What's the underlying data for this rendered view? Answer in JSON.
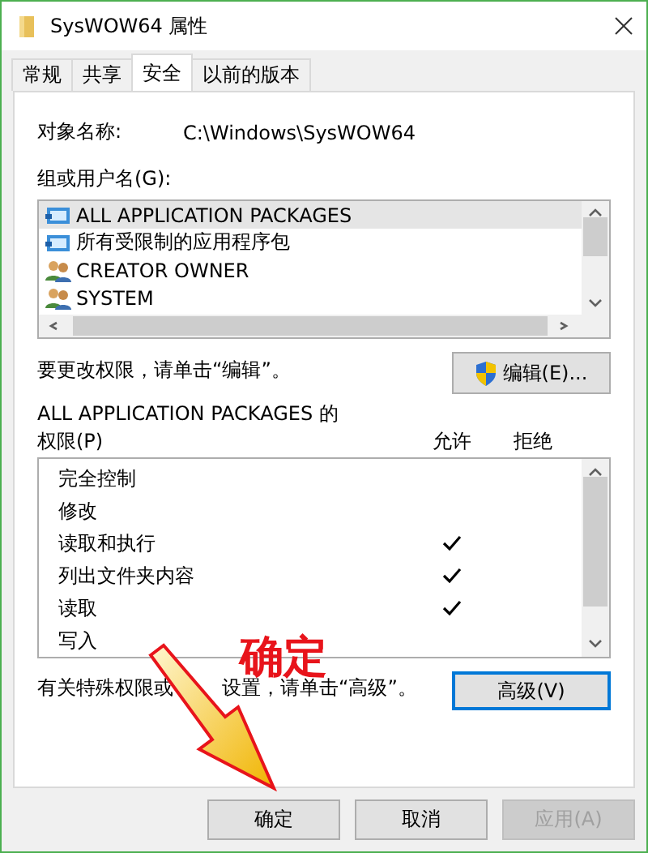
{
  "window": {
    "title": "SysWOW64 属性"
  },
  "tabs": [
    {
      "label": "常规",
      "selected": false
    },
    {
      "label": "共享",
      "selected": false
    },
    {
      "label": "安全",
      "selected": true
    },
    {
      "label": "以前的版本",
      "selected": false
    }
  ],
  "object_name": {
    "label": "对象名称:",
    "value": "C:\\Windows\\SysWOW64"
  },
  "groups": {
    "label": "组或用户名(G):",
    "items": [
      {
        "name": "ALL APPLICATION PACKAGES",
        "kind": "package",
        "selected": true
      },
      {
        "name": "所有受限制的应用程序包",
        "kind": "package",
        "selected": false
      },
      {
        "name": "CREATOR OWNER",
        "kind": "users",
        "selected": false
      },
      {
        "name": "SYSTEM",
        "kind": "users",
        "selected": false
      }
    ]
  },
  "edit_hint": "要更改权限，请单击“编辑”。",
  "edit_button": "编辑(E)...",
  "permissions": {
    "title": "ALL APPLICATION PACKAGES 的",
    "label": "权限(P)",
    "columns": [
      "允许",
      "拒绝"
    ],
    "items": [
      {
        "name": "完全控制",
        "allow": false,
        "deny": false
      },
      {
        "name": "修改",
        "allow": false,
        "deny": false
      },
      {
        "name": "读取和执行",
        "allow": true,
        "deny": false
      },
      {
        "name": "列出文件夹内容",
        "allow": true,
        "deny": false
      },
      {
        "name": "读取",
        "allow": true,
        "deny": false
      },
      {
        "name": "写入",
        "allow": false,
        "deny": false
      }
    ]
  },
  "advanced_hint": [
    "有关特殊权限或",
    "设置，请单击“高级”。"
  ],
  "advanced_button": {
    "label": "高级(V)",
    "focused": true
  },
  "buttons": [
    {
      "label": "确定",
      "disabled": false
    },
    {
      "label": "取消",
      "disabled": false
    },
    {
      "label": "应用(A)",
      "disabled": true
    }
  ],
  "annotation": {
    "text": "确定"
  }
}
